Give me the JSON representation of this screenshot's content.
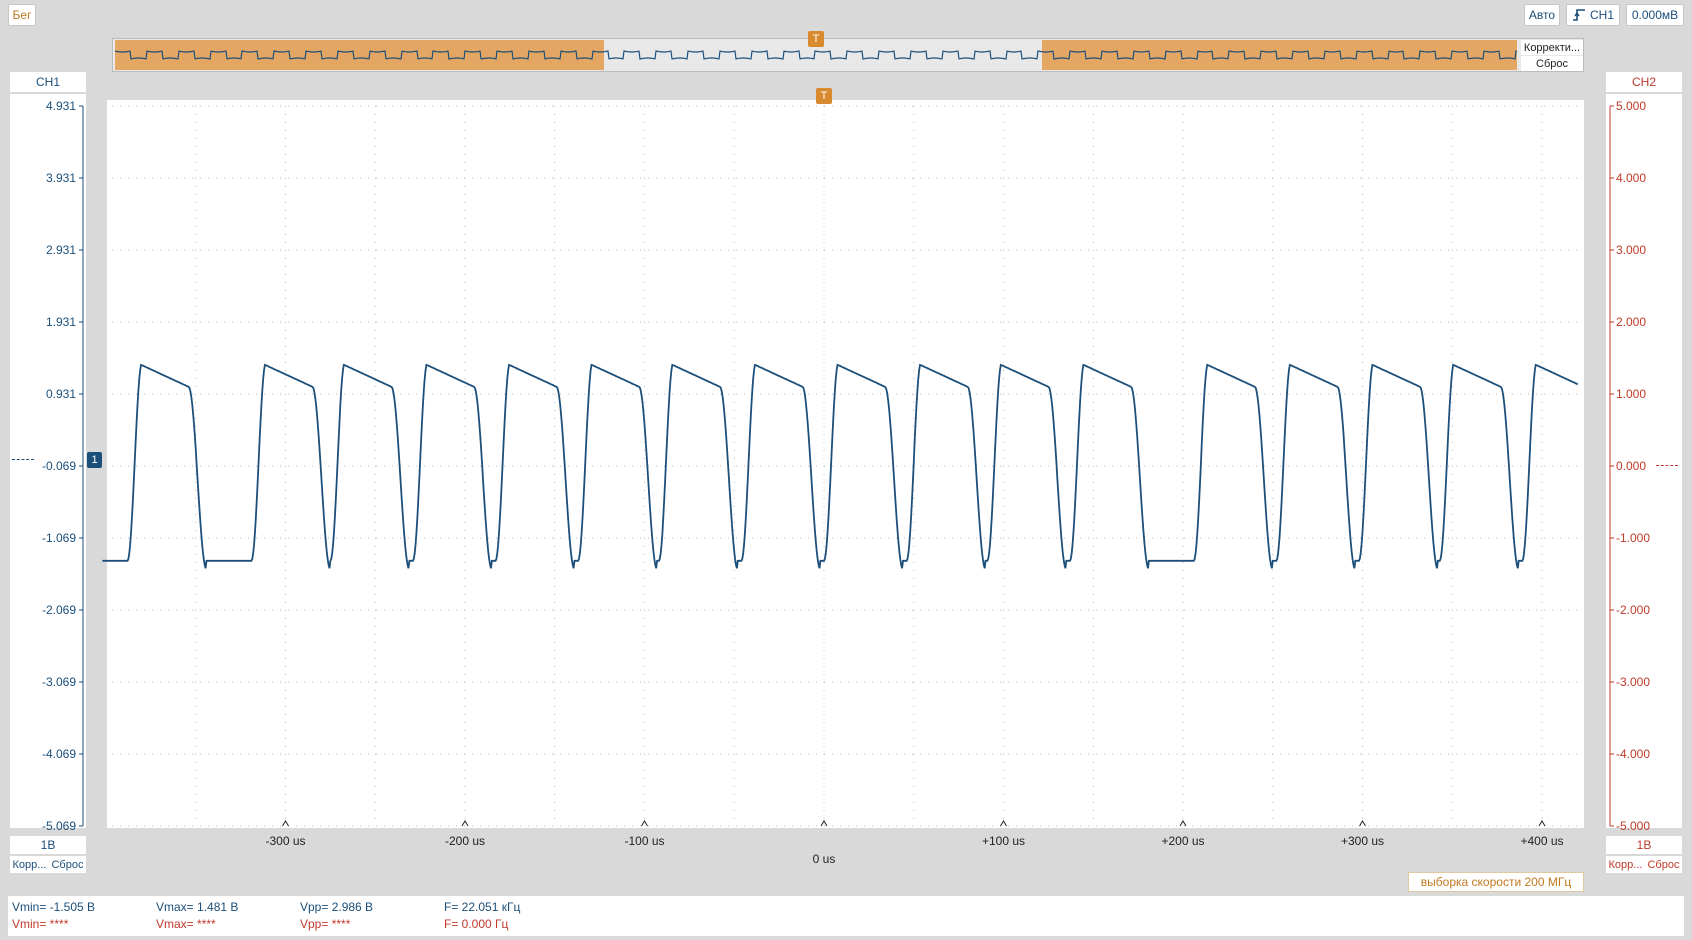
{
  "toolbar": {
    "run_label": "Бег",
    "mode_label": "Авто",
    "trigger_source": "CH1",
    "trigger_level": "0.000мВ"
  },
  "overview": {
    "correct_label": "Корректи...",
    "reset_label": "Сброс",
    "trigger_marker": "T"
  },
  "ch1": {
    "name": "CH1",
    "scale": "1В",
    "ticks": [
      "4.931",
      "3.931",
      "2.931",
      "1.931",
      "0.931",
      "-0.069",
      "-1.069",
      "-2.069",
      "-3.069",
      "-4.069",
      "-5.069"
    ],
    "corr_label": "Корр...",
    "reset_label": "Сброс",
    "marker": "1",
    "color": "#1c4f7a"
  },
  "ch2": {
    "name": "CH2",
    "scale": "1В",
    "ticks": [
      "5.000",
      "4.000",
      "3.000",
      "2.000",
      "1.000",
      "0.000",
      "-1.000",
      "-2.000",
      "-3.000",
      "-4.000",
      "-5.000"
    ],
    "corr_label": "Корр...",
    "reset_label": "Сброс",
    "color": "#c0392b"
  },
  "xaxis": {
    "ticks": [
      "-300 us",
      "-200 us",
      "-100 us",
      "0 us",
      "+100 us",
      "+200 us",
      "+300 us",
      "+400 us"
    ],
    "center_label": "0 us"
  },
  "sample_rate_label": "выборка скорости 200 МГц",
  "measurements": {
    "ch1": {
      "vmin": "Vmin= -1.505 В",
      "vmax": "Vmax= 1.481 В",
      "vpp": "Vpp= 2.986 В",
      "freq": "F= 22.051 кГц"
    },
    "ch2": {
      "vmin": "Vmin= ****",
      "vmax": "Vmax= ****",
      "vpp": "Vpp= ****",
      "freq": "F= 0.000 Гц"
    }
  },
  "chart_data": {
    "type": "line",
    "xlabel": "",
    "ylabel": "",
    "xlim": [
      -402,
      420
    ],
    "ylim": [
      -5.069,
      4.931
    ],
    "grid": true,
    "series": [
      {
        "signal": "distorted square wave",
        "freq_khz": 22.051,
        "vmin": -1.505,
        "vmax": 1.481,
        "high_start_us": [
          -380,
          -311,
          -267,
          -221,
          -175,
          -129,
          -84,
          -38,
          8,
          54,
          99,
          145,
          214,
          260,
          306,
          351,
          397
        ],
        "channel": "CH1"
      }
    ]
  }
}
